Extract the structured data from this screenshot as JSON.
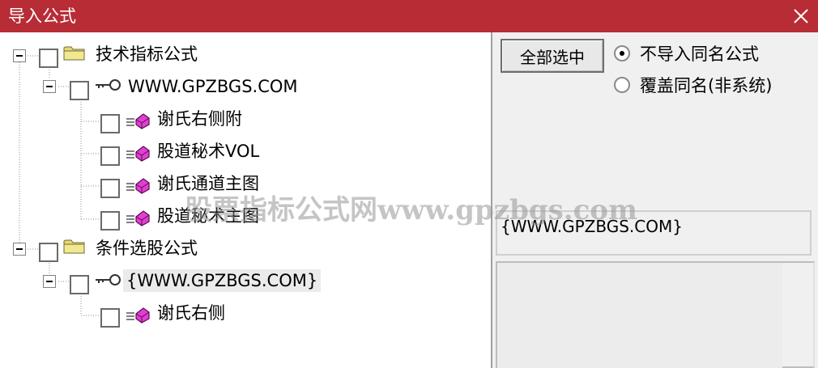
{
  "window": {
    "title": "导入公式",
    "close_icon": "close-icon",
    "accent_color": "#b82c35"
  },
  "tree": {
    "nodes": [
      {
        "label": "技术指标公式",
        "icon": "folder-icon"
      },
      {
        "label": "WWW.GPZBGS.COM",
        "icon": "key-icon"
      },
      {
        "label": "谢氏右侧附",
        "icon": "formula-icon"
      },
      {
        "label": "股道秘术VOL",
        "icon": "formula-icon"
      },
      {
        "label": "谢氏通道主图",
        "icon": "formula-icon"
      },
      {
        "label": "股道秘术主图",
        "icon": "formula-icon"
      },
      {
        "label": "条件选股公式",
        "icon": "folder-icon"
      },
      {
        "label": "{WWW.GPZBGS.COM}",
        "icon": "key-icon"
      },
      {
        "label": "谢氏右侧",
        "icon": "formula-icon"
      }
    ]
  },
  "panel": {
    "select_all_label": "全部选中",
    "options": [
      {
        "label": "不导入同名公式",
        "selected": true
      },
      {
        "label": "覆盖同名(非系统)",
        "selected": false
      }
    ],
    "description": "{WWW.GPZBGS.COM}"
  },
  "watermark": "股票指标公式网www.gpzbgs.com"
}
